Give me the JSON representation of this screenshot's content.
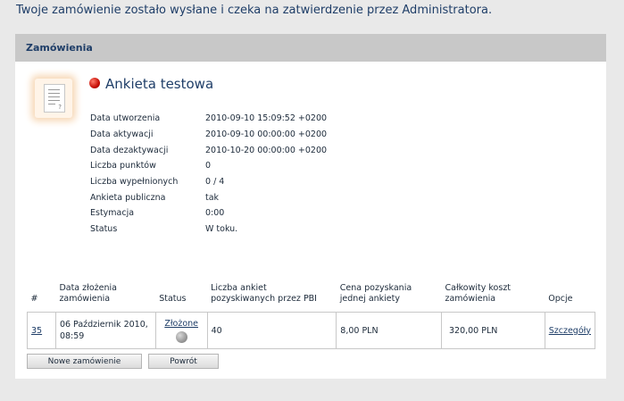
{
  "message": "Twoje zamówienie zostało wysłane i czeka na zatwierdzenie przez Administratora.",
  "panel": {
    "header": "Zamówienia"
  },
  "survey": {
    "title": "Ankieta testowa",
    "status_color": "#d0130a",
    "fields": [
      {
        "label": "Data utworzenia",
        "value": "2010-09-10 15:09:52 +0200"
      },
      {
        "label": "Data aktywacji",
        "value": "2010-09-10 00:00:00 +0200"
      },
      {
        "label": "Data dezaktywacji",
        "value": "2010-10-20 00:00:00 +0200"
      },
      {
        "label": "Liczba punktów",
        "value": "0"
      },
      {
        "label": "Liczba wypełnionych",
        "value": "0 / 4"
      },
      {
        "label": "Ankieta publiczna",
        "value": "tak"
      },
      {
        "label": "Estymacja",
        "value": "0:00"
      },
      {
        "label": "Status",
        "value": "W toku."
      }
    ]
  },
  "orders": {
    "columns": [
      "#",
      "Data złożenia zamówienia",
      "Status",
      "Liczba ankiet pozyskiwanych przez PBI",
      "Cena pozyskania jednej ankiety",
      "Całkowity koszt zamówienia",
      "Opcje"
    ],
    "rows": [
      {
        "id": "35",
        "date": "06 Październik 2010, 08:59",
        "status": "Złożone",
        "count": "40",
        "price": "8,00 PLN",
        "total": "320,00 PLN",
        "option": "Szczegóły"
      }
    ]
  },
  "buttons": {
    "new_order": "Nowe zamówienie",
    "back": "Powrót"
  }
}
